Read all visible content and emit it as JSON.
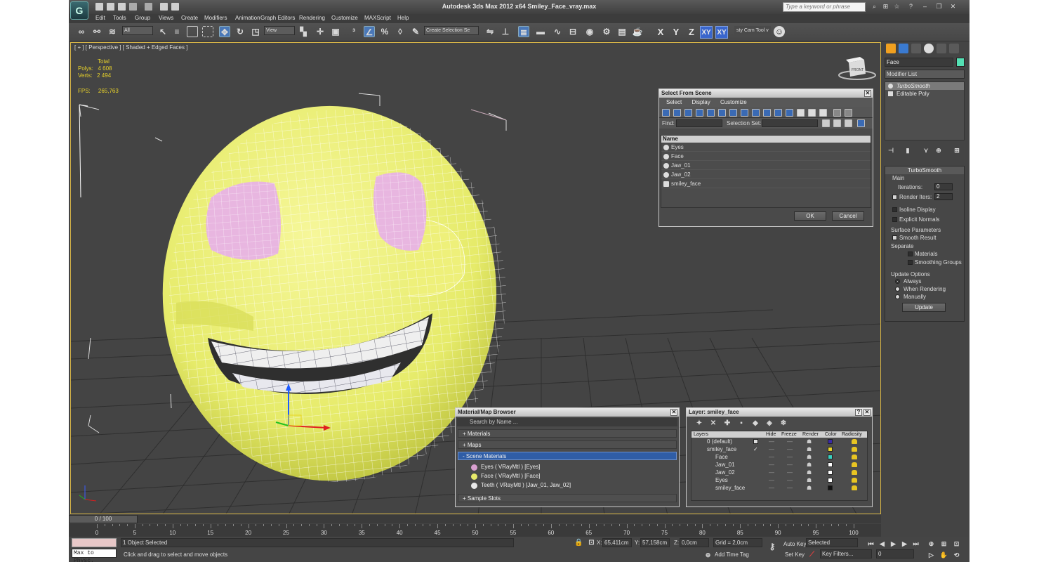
{
  "window": {
    "title": "Autodesk 3ds Max  2012 x64     Smiley_Face_vray.max",
    "search_placeholder": "Type a keyword or phrase"
  },
  "menu": [
    "Edit",
    "Tools",
    "Group",
    "Views",
    "Create",
    "Modifiers",
    "Animation",
    "Graph Editors",
    "Rendering",
    "Customize",
    "MAXScript",
    "Help"
  ],
  "toolbar": {
    "filter": "All",
    "ref_coord": "View",
    "named_selection": "Create Selection Se",
    "axes": [
      "X",
      "Y",
      "Z",
      "XY",
      "XY"
    ],
    "tool_label": "sty Cam Tool v"
  },
  "viewport": {
    "label": "[ + ] [ Perspective ] [ Shaded + Edged Faces ]",
    "stats": {
      "total_label": "Total",
      "polys_label": "Polys:",
      "polys": "4 608",
      "verts_label": "Verts:",
      "verts": "2 494",
      "fps_label": "FPS:",
      "fps": "265,763"
    },
    "viewcube_label": "FRONT"
  },
  "select_from_scene": {
    "title": "Select From Scene",
    "menu": [
      "Select",
      "Display",
      "Customize"
    ],
    "find_label": "Find:",
    "selection_set_label": "Selection Set:",
    "column": "Name",
    "items": [
      "Eyes",
      "Face",
      "Jaw_01",
      "Jaw_02",
      "smiley_face"
    ],
    "ok": "OK",
    "cancel": "Cancel"
  },
  "material_browser": {
    "title": "Material/Map Browser",
    "search_placeholder": "Search by Name ...",
    "categories": [
      "+ Materials",
      "+ Maps",
      "- Scene Materials",
      "+ Sample Slots"
    ],
    "scene_materials": [
      {
        "label": "Eyes  ( VRayMtl ) [Eyes]",
        "color": "#d9a0d0"
      },
      {
        "label": "Face  ( VRayMtl ) [Face]",
        "color": "#e8ea6a"
      },
      {
        "label": "Teeth  ( VRayMtl ) [Jaw_01, Jaw_02]",
        "color": "#e8e8e8"
      }
    ]
  },
  "layers": {
    "title": "Layer: smiley_face",
    "columns": [
      "Layers",
      "Hide",
      "Freeze",
      "Render",
      "Color",
      "Radiosity"
    ],
    "rows": [
      {
        "name": "0 (default)",
        "color": "#3a2aa8",
        "indent": 0
      },
      {
        "name": "smiley_face",
        "color": "#e8d428",
        "indent": 0
      },
      {
        "name": "Face",
        "color": "#38d0c0",
        "indent": 1
      },
      {
        "name": "Jaw_01",
        "color": "#ffffff",
        "indent": 1
      },
      {
        "name": "Jaw_02",
        "color": "#ffffff",
        "indent": 1
      },
      {
        "name": "Eyes",
        "color": "#ffffff",
        "indent": 1
      },
      {
        "name": "smiley_face",
        "color": "#111111",
        "indent": 1
      }
    ]
  },
  "command_panel": {
    "object_name": "Face",
    "object_color": "#54e0b4",
    "modifier_list": "Modifier List",
    "stack": [
      "TurboSmooth",
      "Editable Poly"
    ],
    "turbosmooth": {
      "title": "TurboSmooth",
      "main": "Main",
      "iterations_label": "Iterations:",
      "iterations": "0",
      "render_iters_label": "Render Iters:",
      "render_iters": "2",
      "isoline": "Isoline Display",
      "explicit": "Explicit Normals",
      "surface_params": "Surface Parameters",
      "smooth_result": "Smooth Result",
      "separate": "Separate",
      "materials": "Materials",
      "smoothing_groups": "Smoothing Groups",
      "update_options": "Update Options",
      "always": "Always",
      "when_rendering": "When Rendering",
      "manually": "Manually",
      "update": "Update"
    }
  },
  "timeline": {
    "frame": "0 / 100",
    "ticks": [
      "0",
      "5",
      "10",
      "15",
      "20",
      "25",
      "30",
      "35",
      "40",
      "45",
      "50",
      "55",
      "60",
      "65",
      "70",
      "75",
      "80",
      "85",
      "90",
      "95",
      "100"
    ]
  },
  "status": {
    "maxscript": "Max to Physc.",
    "selection": "1 Object Selected",
    "prompt": "Click and drag to select and move objects",
    "x_label": "X:",
    "x": "65,411cm",
    "y_label": "Y:",
    "y": "57,158cm",
    "z_label": "Z:",
    "z": "0,0cm",
    "grid": "Grid = 2,0cm",
    "add_time_tag": "Add Time Tag",
    "auto_key": "Auto Key",
    "set_key": "Set Key",
    "selected": "Selected",
    "key_filters": "Key Filters...",
    "frame": "0"
  }
}
